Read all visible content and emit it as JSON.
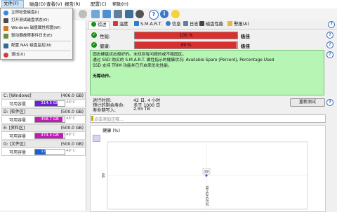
{
  "menubar": {
    "items": [
      "文件(F)",
      "磁盘(D)",
      "查看(V)",
      "报告(R)",
      "配置(C)",
      "帮助(H)"
    ]
  },
  "file_menu": {
    "items": [
      {
        "label": "立即检查磁盘(I)",
        "icon": "refresh-icon",
        "color": "#3a88d6"
      },
      {
        "label": "打开测试磁盘状态(O)",
        "icon": "monitor-icon",
        "color": "#4a4a4a"
      },
      {
        "label": "Windows 磁盘属性视图(W)",
        "icon": "windows-icon",
        "color": "#d07a22"
      },
      {
        "label": "驱动器故障事件日志(E)",
        "icon": "log-icon",
        "color": "#6a8f3a"
      },
      {
        "label": "配置 NAS 磁盘监控(N)",
        "icon": "nas-icon",
        "color": "#2e6c9c"
      },
      {
        "label": "退出(X)",
        "icon": "exit-icon",
        "color": "#d93a3a"
      }
    ]
  },
  "tabs": [
    "综述",
    "温度",
    "S.M.A.R.T.",
    "信息",
    "日志",
    "磁盘性能",
    "警报(A)"
  ],
  "status": {
    "performance": {
      "label": "性能:",
      "percent": 100,
      "percent_text": "100 %",
      "verdict": "极佳"
    },
    "health": {
      "label": "健康:",
      "percent": 99,
      "percent_text": "99 %",
      "verdict": "极佳"
    }
  },
  "info": {
    "lines": [
      "固态硬盘状态极好的。未找到有问题的或不稳固区。",
      "通过 SSD 购买的 S.M.A.R.T. 属性指示的健康状况:    Available Spare (Percent), Percentage Used",
      "SSD 支持 TRIM 功能并已开启来优化性能。"
    ],
    "action": "无需动作。"
  },
  "details": {
    "power_on_label": "运行时间:",
    "power_on_value": "42 日, 4 小时",
    "remaining_label": "预计的剩余寿命:",
    "remaining_value": "多于 1000 日",
    "written_label": "寿命期写入:",
    "written_value": "2.55 TB",
    "recheck_button": "重新测试"
  },
  "note": {
    "placeholder": "点击添加注释..."
  },
  "drives": [
    {
      "name": "C: [Windows]",
      "size": "(406.0 GB)",
      "free_label": "可用容量",
      "free_value": "314.5 GB",
      "free_percent": 77,
      "temp": "46°C",
      "color": "#6b1fe0"
    },
    {
      "name": "D: [软件区]",
      "size": "(500.0 GB)",
      "free_label": "可用容量",
      "free_value": "458.7 GB",
      "free_percent": 92,
      "temp": "46°C",
      "color": "#c21ab8"
    },
    {
      "name": "E: [资料区]",
      "size": "(500.0 GB)",
      "free_label": "可用容量",
      "free_value": "474.4 GB",
      "free_percent": 95,
      "temp": "46°C",
      "color": "#c21ab8"
    },
    {
      "name": "G: [文件区]",
      "size": "(500.0 GB)",
      "free_label": "可用容量",
      "free_value": "172.5 GB",
      "free_percent": 35,
      "temp": "46°C",
      "color": "#1a5fd6"
    }
  ],
  "chart_data": {
    "type": "line",
    "title": "健康 (%)",
    "x": [
      "2020-09-06"
    ],
    "series": [
      {
        "values": [
          99
        ]
      }
    ],
    "y_tick": "99",
    "point_label": "99"
  }
}
